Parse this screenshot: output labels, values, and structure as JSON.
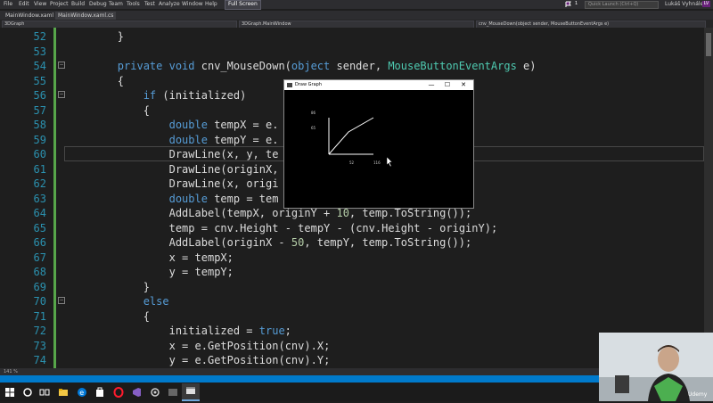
{
  "menu": [
    "File",
    "Edit",
    "View",
    "Project",
    "Build",
    "Debug",
    "Team",
    "Tools",
    "Test",
    "Analyze",
    "Window",
    "Help"
  ],
  "fullscreen_label": "Full Screen",
  "quick_launch_placeholder": "Quick Launch (Ctrl+Q)",
  "user_name": "Lukáš Vyhnálek",
  "user_initials": "LV",
  "notification_count": "1",
  "tabs": [
    "MainWindow.xaml",
    "MainWindow.xaml.cs"
  ],
  "nav": {
    "project": "3DGraph",
    "class": "3DGraph.MainWindow",
    "member": "cnv_MouseDown(object sender, MouseButtonEventArgs e)"
  },
  "zoom": "141 %",
  "code_lines": [
    {
      "num": "52",
      "text": "        }"
    },
    {
      "num": "53",
      "text": ""
    },
    {
      "num": "54",
      "text": "        private void cnv_MouseDown(object sender, MouseButtonEventArgs e)"
    },
    {
      "num": "55",
      "text": "        {"
    },
    {
      "num": "56",
      "text": "            if (initialized)"
    },
    {
      "num": "57",
      "text": "            {"
    },
    {
      "num": "58",
      "text": "                double tempX = e."
    },
    {
      "num": "59",
      "text": "                double tempY = e."
    },
    {
      "num": "60",
      "text": "                DrawLine(x, y, te"
    },
    {
      "num": "61",
      "text": "                DrawLine(originX,"
    },
    {
      "num": "62",
      "text": "                DrawLine(x, origi"
    },
    {
      "num": "63",
      "text": "                double temp = tem"
    },
    {
      "num": "64",
      "text": "                AddLabel(tempX, originY + 10, temp.ToString());"
    },
    {
      "num": "65",
      "text": "                temp = cnv.Height - tempY - (cnv.Height - originY);"
    },
    {
      "num": "66",
      "text": "                AddLabel(originX - 50, tempY, temp.ToString());"
    },
    {
      "num": "67",
      "text": "                x = tempX;"
    },
    {
      "num": "68",
      "text": "                y = tempY;"
    },
    {
      "num": "69",
      "text": "            }"
    },
    {
      "num": "70",
      "text": "            else"
    },
    {
      "num": "71",
      "text": "            {"
    },
    {
      "num": "72",
      "text": "                initialized = true;"
    },
    {
      "num": "73",
      "text": "                x = e.GetPosition(cnv).X;"
    },
    {
      "num": "74",
      "text": "                y = e.GetPosition(cnv).Y;"
    }
  ],
  "graph_window": {
    "title": "Draw Graph",
    "minimize": "—",
    "maximize": "☐",
    "close": "✕",
    "y_labels": [
      "86",
      "65"
    ],
    "x_labels": [
      "52",
      "116"
    ]
  },
  "webcam_logo": "Udemy",
  "colors": {
    "keyword": "#569cd6",
    "type": "#4ec9b0",
    "number": "#b5cea8",
    "line_number": "#2b91af",
    "status_bar": "#007acc"
  }
}
